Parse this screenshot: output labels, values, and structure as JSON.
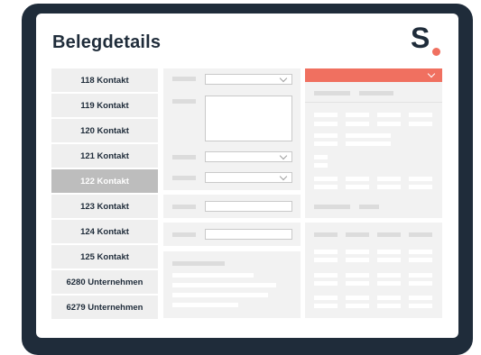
{
  "page": {
    "title": "Belegdetails"
  },
  "logo": {
    "letter": "S",
    "accent_color": "#f07060"
  },
  "list": {
    "items": [
      {
        "label": "118 Kontakt"
      },
      {
        "label": "119 Kontakt"
      },
      {
        "label": "120 Kontakt"
      },
      {
        "label": "121 Kontakt"
      },
      {
        "label": "122 Kontakt",
        "selected": true
      },
      {
        "label": "123 Kontakt"
      },
      {
        "label": "124 Kontakt"
      },
      {
        "label": "125 Kontakt"
      },
      {
        "label": "6280 Unternehmen"
      },
      {
        "label": "6279 Unternehmen"
      }
    ]
  },
  "colors": {
    "frame": "#1f2c3a",
    "accent": "#f07060",
    "selected": "#bdbdbd",
    "panel": "#f2f2f2"
  },
  "icons": {
    "dropdown": "chevron-down-icon"
  }
}
